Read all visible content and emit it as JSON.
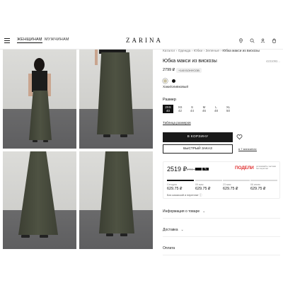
{
  "header": {
    "nav_women": "ЖЕНЩИНАМ",
    "separator": "|",
    "nav_men": "МУЖЧИНАМ",
    "logo": "ZARINA",
    "icons": [
      "location-icon",
      "search-icon",
      "user-icon",
      "cart-icon"
    ]
  },
  "breadcrumb": {
    "items": [
      "Каталог",
      "Одежда",
      "Юбки",
      "Зеленые"
    ],
    "separator": "›",
    "current": "Юбка макси из вискозы"
  },
  "product": {
    "title": "Юбка макси из вискозы",
    "article": "4231092...",
    "price": "2799 ₽",
    "bonus": "+140 БОНУСОВ",
    "colors": [
      {
        "name": "Хаки",
        "hex": "#c9c2a3"
      },
      {
        "name": "Черный",
        "hex": "#111111"
      }
    ],
    "selected_color": "Хаки/оливковый",
    "size_label": "Размер",
    "sizes": [
      {
        "alpha": "2XS",
        "num": "40",
        "selected": true
      },
      {
        "alpha": "XS",
        "num": "42",
        "selected": false
      },
      {
        "alpha": "S",
        "num": "44",
        "selected": false
      },
      {
        "alpha": "M",
        "num": "46",
        "selected": false
      },
      {
        "alpha": "L",
        "num": "48",
        "selected": false
      },
      {
        "alpha": "XL",
        "num": "50",
        "selected": false
      }
    ],
    "size_table": "Таблица размеров",
    "cart_button": "В КОРЗИНУ",
    "quick_order": "БЫСТРЫЙ ЗАКАЗ",
    "in_stores": "в 7 магазинах"
  },
  "split": {
    "price": "2519 ₽",
    "old_price": "2799 ₽",
    "brand": "ПОДЕЛИ",
    "caption": "оплачивайте частями без переплат",
    "payments": [
      {
        "date": "Сегодня",
        "amount": "629.75 ₽",
        "active": true
      },
      {
        "date": "09 мая",
        "amount": "629.75 ₽",
        "active": false
      },
      {
        "date": "23 мая",
        "amount": "629.75 ₽",
        "active": false
      },
      {
        "date": "06 июня",
        "amount": "629.75 ₽",
        "active": false
      }
    ],
    "no_fee": "Без комиссий и переплат"
  },
  "accordion": [
    {
      "label": "Информация о товаре"
    },
    {
      "label": "Доставка"
    },
    {
      "label": "Оплата"
    }
  ],
  "colors": {
    "accent": "#111111",
    "split_brand": "#e03636",
    "skirt": "#4a4d3e"
  }
}
